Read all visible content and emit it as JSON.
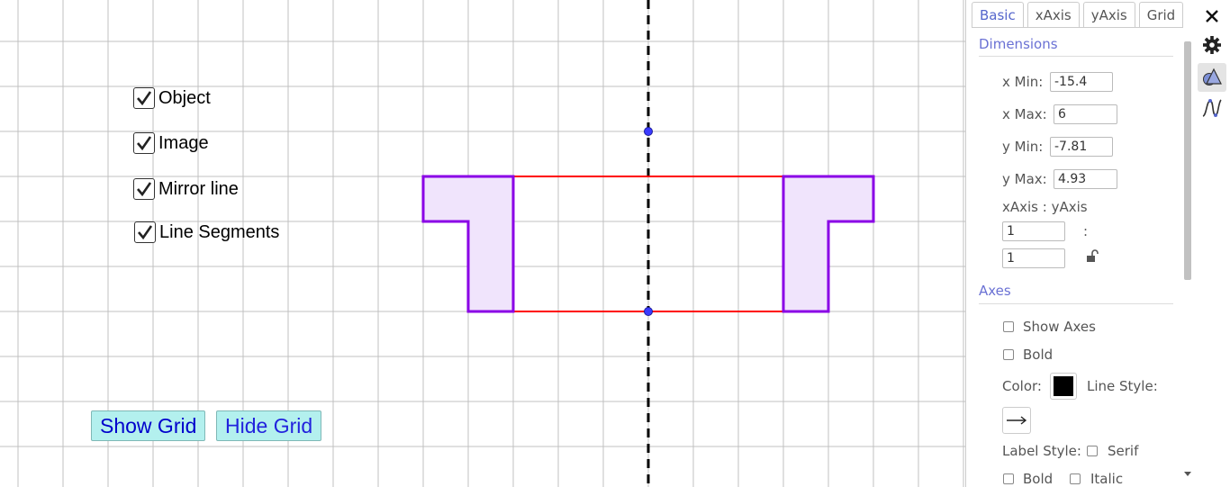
{
  "checkboxes": [
    {
      "label": "Object",
      "checked": true
    },
    {
      "label": "Image",
      "checked": true
    },
    {
      "label": "Mirror line",
      "checked": true
    },
    {
      "label": "Line Segments",
      "checked": true
    }
  ],
  "buttons": {
    "show_grid": "Show Grid",
    "hide_grid": "Hide Grid"
  },
  "panel": {
    "tabs": [
      "Basic",
      "xAxis",
      "yAxis",
      "Grid"
    ],
    "dimensions": {
      "section": "Dimensions",
      "xmin_label": "x Min:",
      "xmin": "-15.4",
      "xmax_label": "x Max:",
      "xmax": "6",
      "ymin_label": "y Min:",
      "ymin": "-7.81",
      "ymax_label": "y Max:",
      "ymax": "4.93",
      "ratio_label": "xAxis : yAxis",
      "ratio_colon": ":",
      "ratio_x": "1",
      "ratio_y": "1"
    },
    "axes": {
      "section": "Axes",
      "show_axes": "Show Axes",
      "bold": "Bold",
      "color_label": "Color:",
      "line_style_label": "Line Style:",
      "label_style_label": "Label Style:",
      "serif": "Serif",
      "bold2": "Bold",
      "italic": "Italic"
    }
  },
  "colors": {
    "shape_stroke": "#8a00e6",
    "shape_fill": "#f0e4fc",
    "segment": "#ff0000",
    "point": "#3b3bff",
    "button_bg": "#b3f0ee",
    "button_text": "#0000cc",
    "tab_active": "#5566cc",
    "axis_color": "#000000"
  },
  "icons": {
    "close": "close-icon",
    "settings": "gear-icon",
    "graphics": "graphics-view-icon",
    "algebra": "function-graph-icon"
  }
}
